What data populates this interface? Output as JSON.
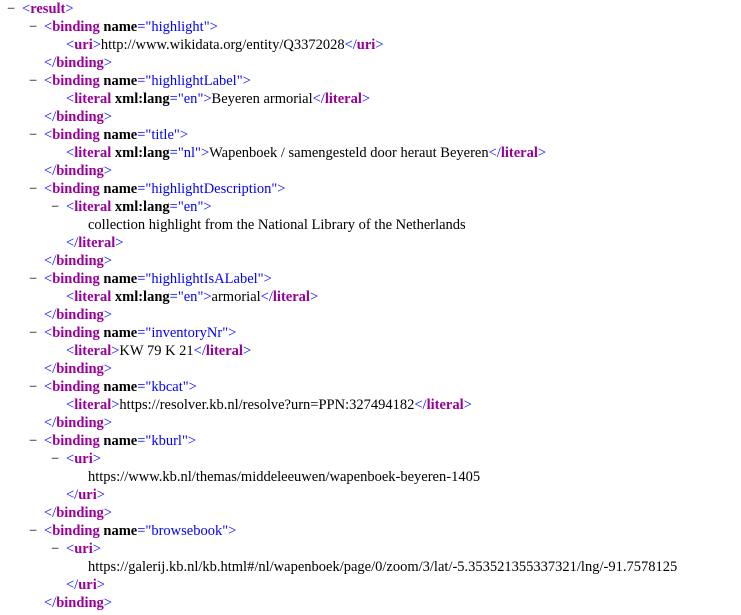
{
  "toggle_glyph": "−",
  "lines": [
    {
      "indent": 0,
      "toggle": true,
      "tokens": [
        [
          "punct",
          "<"
        ],
        [
          "tag",
          "result"
        ],
        [
          "punct",
          ">"
        ]
      ]
    },
    {
      "indent": 1,
      "toggle": true,
      "tokens": [
        [
          "punct",
          "<"
        ],
        [
          "tag",
          "binding"
        ],
        [
          "attr",
          " name"
        ],
        [
          "punct",
          "=\""
        ],
        [
          "val",
          "highlight"
        ],
        [
          "punct",
          "\">"
        ]
      ]
    },
    {
      "indent": 2,
      "toggle": false,
      "tokens": [
        [
          "punct",
          "<"
        ],
        [
          "tag",
          "uri"
        ],
        [
          "punct",
          ">"
        ],
        [
          "text",
          "http://www.wikidata.org/entity/Q3372028"
        ],
        [
          "punct",
          "</"
        ],
        [
          "tag",
          "uri"
        ],
        [
          "punct",
          ">"
        ]
      ]
    },
    {
      "indent": 1,
      "toggle": false,
      "tokens": [
        [
          "punct",
          "</"
        ],
        [
          "tag",
          "binding"
        ],
        [
          "punct",
          ">"
        ]
      ]
    },
    {
      "indent": 1,
      "toggle": true,
      "tokens": [
        [
          "punct",
          "<"
        ],
        [
          "tag",
          "binding"
        ],
        [
          "attr",
          " name"
        ],
        [
          "punct",
          "=\""
        ],
        [
          "val",
          "highlightLabel"
        ],
        [
          "punct",
          "\">"
        ]
      ]
    },
    {
      "indent": 2,
      "toggle": false,
      "tokens": [
        [
          "punct",
          "<"
        ],
        [
          "tag",
          "literal"
        ],
        [
          "attr",
          " xml:lang"
        ],
        [
          "punct",
          "=\""
        ],
        [
          "val",
          "en"
        ],
        [
          "punct",
          "\">"
        ],
        [
          "text",
          "Beyeren armorial"
        ],
        [
          "punct",
          "</"
        ],
        [
          "tag",
          "literal"
        ],
        [
          "punct",
          ">"
        ]
      ]
    },
    {
      "indent": 1,
      "toggle": false,
      "tokens": [
        [
          "punct",
          "</"
        ],
        [
          "tag",
          "binding"
        ],
        [
          "punct",
          ">"
        ]
      ]
    },
    {
      "indent": 1,
      "toggle": true,
      "tokens": [
        [
          "punct",
          "<"
        ],
        [
          "tag",
          "binding"
        ],
        [
          "attr",
          " name"
        ],
        [
          "punct",
          "=\""
        ],
        [
          "val",
          "title"
        ],
        [
          "punct",
          "\">"
        ]
      ]
    },
    {
      "indent": 2,
      "toggle": false,
      "tokens": [
        [
          "punct",
          "<"
        ],
        [
          "tag",
          "literal"
        ],
        [
          "attr",
          " xml:lang"
        ],
        [
          "punct",
          "=\""
        ],
        [
          "val",
          "nl"
        ],
        [
          "punct",
          "\">"
        ],
        [
          "text",
          "Wapenboek / samengesteld door heraut Beyeren"
        ],
        [
          "punct",
          "</"
        ],
        [
          "tag",
          "literal"
        ],
        [
          "punct",
          ">"
        ]
      ]
    },
    {
      "indent": 1,
      "toggle": false,
      "tokens": [
        [
          "punct",
          "</"
        ],
        [
          "tag",
          "binding"
        ],
        [
          "punct",
          ">"
        ]
      ]
    },
    {
      "indent": 1,
      "toggle": true,
      "tokens": [
        [
          "punct",
          "<"
        ],
        [
          "tag",
          "binding"
        ],
        [
          "attr",
          " name"
        ],
        [
          "punct",
          "=\""
        ],
        [
          "val",
          "highlightDescription"
        ],
        [
          "punct",
          "\">"
        ]
      ]
    },
    {
      "indent": 2,
      "toggle": true,
      "tokens": [
        [
          "punct",
          "<"
        ],
        [
          "tag",
          "literal"
        ],
        [
          "attr",
          " xml:lang"
        ],
        [
          "punct",
          "=\""
        ],
        [
          "val",
          "en"
        ],
        [
          "punct",
          "\">"
        ]
      ]
    },
    {
      "indent": 3,
      "toggle": false,
      "tokens": [
        [
          "text",
          "collection highlight from the National Library of the Netherlands"
        ]
      ]
    },
    {
      "indent": 2,
      "toggle": false,
      "tokens": [
        [
          "punct",
          "</"
        ],
        [
          "tag",
          "literal"
        ],
        [
          "punct",
          ">"
        ]
      ]
    },
    {
      "indent": 1,
      "toggle": false,
      "tokens": [
        [
          "punct",
          "</"
        ],
        [
          "tag",
          "binding"
        ],
        [
          "punct",
          ">"
        ]
      ]
    },
    {
      "indent": 1,
      "toggle": true,
      "tokens": [
        [
          "punct",
          "<"
        ],
        [
          "tag",
          "binding"
        ],
        [
          "attr",
          " name"
        ],
        [
          "punct",
          "=\""
        ],
        [
          "val",
          "highlightIsALabel"
        ],
        [
          "punct",
          "\">"
        ]
      ]
    },
    {
      "indent": 2,
      "toggle": false,
      "tokens": [
        [
          "punct",
          "<"
        ],
        [
          "tag",
          "literal"
        ],
        [
          "attr",
          " xml:lang"
        ],
        [
          "punct",
          "=\""
        ],
        [
          "val",
          "en"
        ],
        [
          "punct",
          "\">"
        ],
        [
          "text",
          "armorial"
        ],
        [
          "punct",
          "</"
        ],
        [
          "tag",
          "literal"
        ],
        [
          "punct",
          ">"
        ]
      ]
    },
    {
      "indent": 1,
      "toggle": false,
      "tokens": [
        [
          "punct",
          "</"
        ],
        [
          "tag",
          "binding"
        ],
        [
          "punct",
          ">"
        ]
      ]
    },
    {
      "indent": 1,
      "toggle": true,
      "tokens": [
        [
          "punct",
          "<"
        ],
        [
          "tag",
          "binding"
        ],
        [
          "attr",
          " name"
        ],
        [
          "punct",
          "=\""
        ],
        [
          "val",
          "inventoryNr"
        ],
        [
          "punct",
          "\">"
        ]
      ]
    },
    {
      "indent": 2,
      "toggle": false,
      "tokens": [
        [
          "punct",
          "<"
        ],
        [
          "tag",
          "literal"
        ],
        [
          "punct",
          ">"
        ],
        [
          "text",
          "KW 79 K 21"
        ],
        [
          "punct",
          "</"
        ],
        [
          "tag",
          "literal"
        ],
        [
          "punct",
          ">"
        ]
      ]
    },
    {
      "indent": 1,
      "toggle": false,
      "tokens": [
        [
          "punct",
          "</"
        ],
        [
          "tag",
          "binding"
        ],
        [
          "punct",
          ">"
        ]
      ]
    },
    {
      "indent": 1,
      "toggle": true,
      "tokens": [
        [
          "punct",
          "<"
        ],
        [
          "tag",
          "binding"
        ],
        [
          "attr",
          " name"
        ],
        [
          "punct",
          "=\""
        ],
        [
          "val",
          "kbcat"
        ],
        [
          "punct",
          "\">"
        ]
      ]
    },
    {
      "indent": 2,
      "toggle": false,
      "tokens": [
        [
          "punct",
          "<"
        ],
        [
          "tag",
          "literal"
        ],
        [
          "punct",
          ">"
        ],
        [
          "text",
          "https://resolver.kb.nl/resolve?urn=PPN:327494182"
        ],
        [
          "punct",
          "</"
        ],
        [
          "tag",
          "literal"
        ],
        [
          "punct",
          ">"
        ]
      ]
    },
    {
      "indent": 1,
      "toggle": false,
      "tokens": [
        [
          "punct",
          "</"
        ],
        [
          "tag",
          "binding"
        ],
        [
          "punct",
          ">"
        ]
      ]
    },
    {
      "indent": 1,
      "toggle": true,
      "tokens": [
        [
          "punct",
          "<"
        ],
        [
          "tag",
          "binding"
        ],
        [
          "attr",
          " name"
        ],
        [
          "punct",
          "=\""
        ],
        [
          "val",
          "kburl"
        ],
        [
          "punct",
          "\">"
        ]
      ]
    },
    {
      "indent": 2,
      "toggle": true,
      "tokens": [
        [
          "punct",
          "<"
        ],
        [
          "tag",
          "uri"
        ],
        [
          "punct",
          ">"
        ]
      ]
    },
    {
      "indent": 3,
      "toggle": false,
      "tokens": [
        [
          "text",
          "https://www.kb.nl/themas/middeleeuwen/wapenboek-beyeren-1405"
        ]
      ]
    },
    {
      "indent": 2,
      "toggle": false,
      "tokens": [
        [
          "punct",
          "</"
        ],
        [
          "tag",
          "uri"
        ],
        [
          "punct",
          ">"
        ]
      ]
    },
    {
      "indent": 1,
      "toggle": false,
      "tokens": [
        [
          "punct",
          "</"
        ],
        [
          "tag",
          "binding"
        ],
        [
          "punct",
          ">"
        ]
      ]
    },
    {
      "indent": 1,
      "toggle": true,
      "tokens": [
        [
          "punct",
          "<"
        ],
        [
          "tag",
          "binding"
        ],
        [
          "attr",
          " name"
        ],
        [
          "punct",
          "=\""
        ],
        [
          "val",
          "browsebook"
        ],
        [
          "punct",
          "\">"
        ]
      ]
    },
    {
      "indent": 2,
      "toggle": true,
      "tokens": [
        [
          "punct",
          "<"
        ],
        [
          "tag",
          "uri"
        ],
        [
          "punct",
          ">"
        ]
      ]
    },
    {
      "indent": 3,
      "toggle": false,
      "tokens": [
        [
          "text",
          "https://galerij.kb.nl/kb.html#/nl/wapenboek/page/0/zoom/3/lat/-5.353521355337321/lng/-91.7578125"
        ]
      ]
    },
    {
      "indent": 2,
      "toggle": false,
      "tokens": [
        [
          "punct",
          "</"
        ],
        [
          "tag",
          "uri"
        ],
        [
          "punct",
          ">"
        ]
      ]
    },
    {
      "indent": 1,
      "toggle": false,
      "tokens": [
        [
          "punct",
          "</"
        ],
        [
          "tag",
          "binding"
        ],
        [
          "punct",
          ">"
        ]
      ]
    }
  ]
}
